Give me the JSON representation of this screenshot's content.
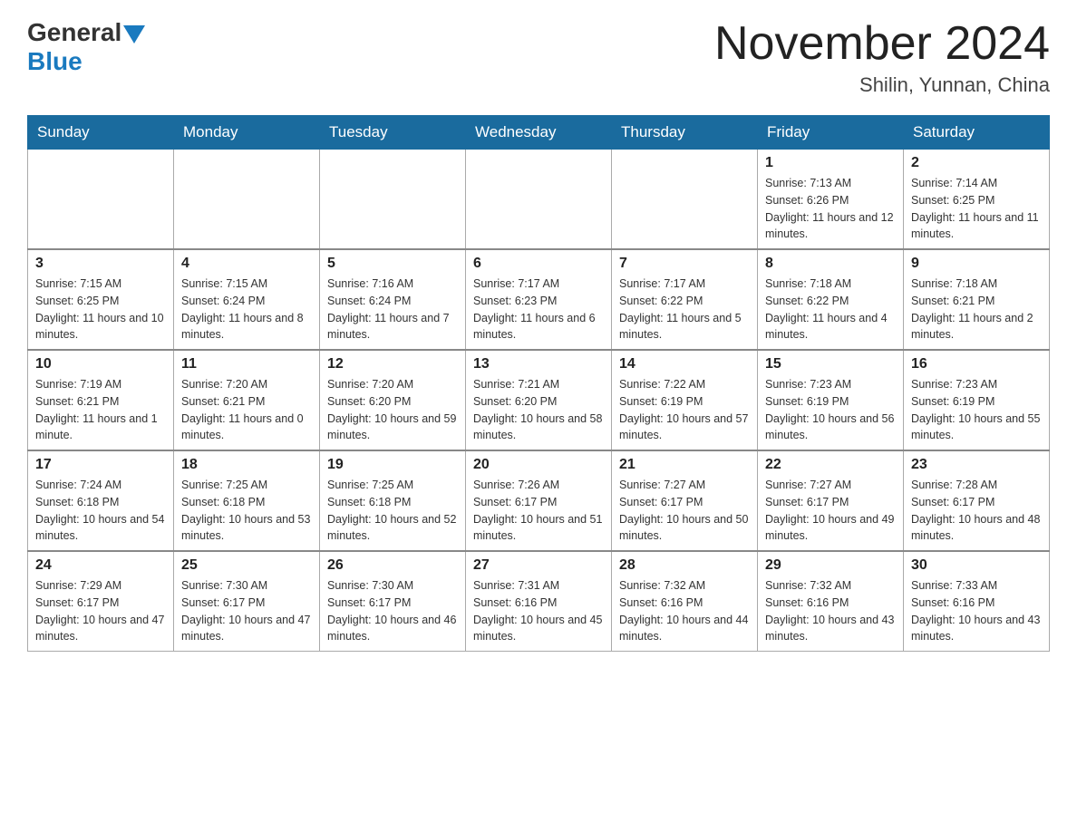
{
  "header": {
    "title": "November 2024",
    "subtitle": "Shilin, Yunnan, China",
    "logo_general": "General",
    "logo_blue": "Blue"
  },
  "weekdays": [
    "Sunday",
    "Monday",
    "Tuesday",
    "Wednesday",
    "Thursday",
    "Friday",
    "Saturday"
  ],
  "weeks": [
    [
      {
        "day": "",
        "info": ""
      },
      {
        "day": "",
        "info": ""
      },
      {
        "day": "",
        "info": ""
      },
      {
        "day": "",
        "info": ""
      },
      {
        "day": "",
        "info": ""
      },
      {
        "day": "1",
        "info": "Sunrise: 7:13 AM\nSunset: 6:26 PM\nDaylight: 11 hours and 12 minutes."
      },
      {
        "day": "2",
        "info": "Sunrise: 7:14 AM\nSunset: 6:25 PM\nDaylight: 11 hours and 11 minutes."
      }
    ],
    [
      {
        "day": "3",
        "info": "Sunrise: 7:15 AM\nSunset: 6:25 PM\nDaylight: 11 hours and 10 minutes."
      },
      {
        "day": "4",
        "info": "Sunrise: 7:15 AM\nSunset: 6:24 PM\nDaylight: 11 hours and 8 minutes."
      },
      {
        "day": "5",
        "info": "Sunrise: 7:16 AM\nSunset: 6:24 PM\nDaylight: 11 hours and 7 minutes."
      },
      {
        "day": "6",
        "info": "Sunrise: 7:17 AM\nSunset: 6:23 PM\nDaylight: 11 hours and 6 minutes."
      },
      {
        "day": "7",
        "info": "Sunrise: 7:17 AM\nSunset: 6:22 PM\nDaylight: 11 hours and 5 minutes."
      },
      {
        "day": "8",
        "info": "Sunrise: 7:18 AM\nSunset: 6:22 PM\nDaylight: 11 hours and 4 minutes."
      },
      {
        "day": "9",
        "info": "Sunrise: 7:18 AM\nSunset: 6:21 PM\nDaylight: 11 hours and 2 minutes."
      }
    ],
    [
      {
        "day": "10",
        "info": "Sunrise: 7:19 AM\nSunset: 6:21 PM\nDaylight: 11 hours and 1 minute."
      },
      {
        "day": "11",
        "info": "Sunrise: 7:20 AM\nSunset: 6:21 PM\nDaylight: 11 hours and 0 minutes."
      },
      {
        "day": "12",
        "info": "Sunrise: 7:20 AM\nSunset: 6:20 PM\nDaylight: 10 hours and 59 minutes."
      },
      {
        "day": "13",
        "info": "Sunrise: 7:21 AM\nSunset: 6:20 PM\nDaylight: 10 hours and 58 minutes."
      },
      {
        "day": "14",
        "info": "Sunrise: 7:22 AM\nSunset: 6:19 PM\nDaylight: 10 hours and 57 minutes."
      },
      {
        "day": "15",
        "info": "Sunrise: 7:23 AM\nSunset: 6:19 PM\nDaylight: 10 hours and 56 minutes."
      },
      {
        "day": "16",
        "info": "Sunrise: 7:23 AM\nSunset: 6:19 PM\nDaylight: 10 hours and 55 minutes."
      }
    ],
    [
      {
        "day": "17",
        "info": "Sunrise: 7:24 AM\nSunset: 6:18 PM\nDaylight: 10 hours and 54 minutes."
      },
      {
        "day": "18",
        "info": "Sunrise: 7:25 AM\nSunset: 6:18 PM\nDaylight: 10 hours and 53 minutes."
      },
      {
        "day": "19",
        "info": "Sunrise: 7:25 AM\nSunset: 6:18 PM\nDaylight: 10 hours and 52 minutes."
      },
      {
        "day": "20",
        "info": "Sunrise: 7:26 AM\nSunset: 6:17 PM\nDaylight: 10 hours and 51 minutes."
      },
      {
        "day": "21",
        "info": "Sunrise: 7:27 AM\nSunset: 6:17 PM\nDaylight: 10 hours and 50 minutes."
      },
      {
        "day": "22",
        "info": "Sunrise: 7:27 AM\nSunset: 6:17 PM\nDaylight: 10 hours and 49 minutes."
      },
      {
        "day": "23",
        "info": "Sunrise: 7:28 AM\nSunset: 6:17 PM\nDaylight: 10 hours and 48 minutes."
      }
    ],
    [
      {
        "day": "24",
        "info": "Sunrise: 7:29 AM\nSunset: 6:17 PM\nDaylight: 10 hours and 47 minutes."
      },
      {
        "day": "25",
        "info": "Sunrise: 7:30 AM\nSunset: 6:17 PM\nDaylight: 10 hours and 47 minutes."
      },
      {
        "day": "26",
        "info": "Sunrise: 7:30 AM\nSunset: 6:17 PM\nDaylight: 10 hours and 46 minutes."
      },
      {
        "day": "27",
        "info": "Sunrise: 7:31 AM\nSunset: 6:16 PM\nDaylight: 10 hours and 45 minutes."
      },
      {
        "day": "28",
        "info": "Sunrise: 7:32 AM\nSunset: 6:16 PM\nDaylight: 10 hours and 44 minutes."
      },
      {
        "day": "29",
        "info": "Sunrise: 7:32 AM\nSunset: 6:16 PM\nDaylight: 10 hours and 43 minutes."
      },
      {
        "day": "30",
        "info": "Sunrise: 7:33 AM\nSunset: 6:16 PM\nDaylight: 10 hours and 43 minutes."
      }
    ]
  ]
}
